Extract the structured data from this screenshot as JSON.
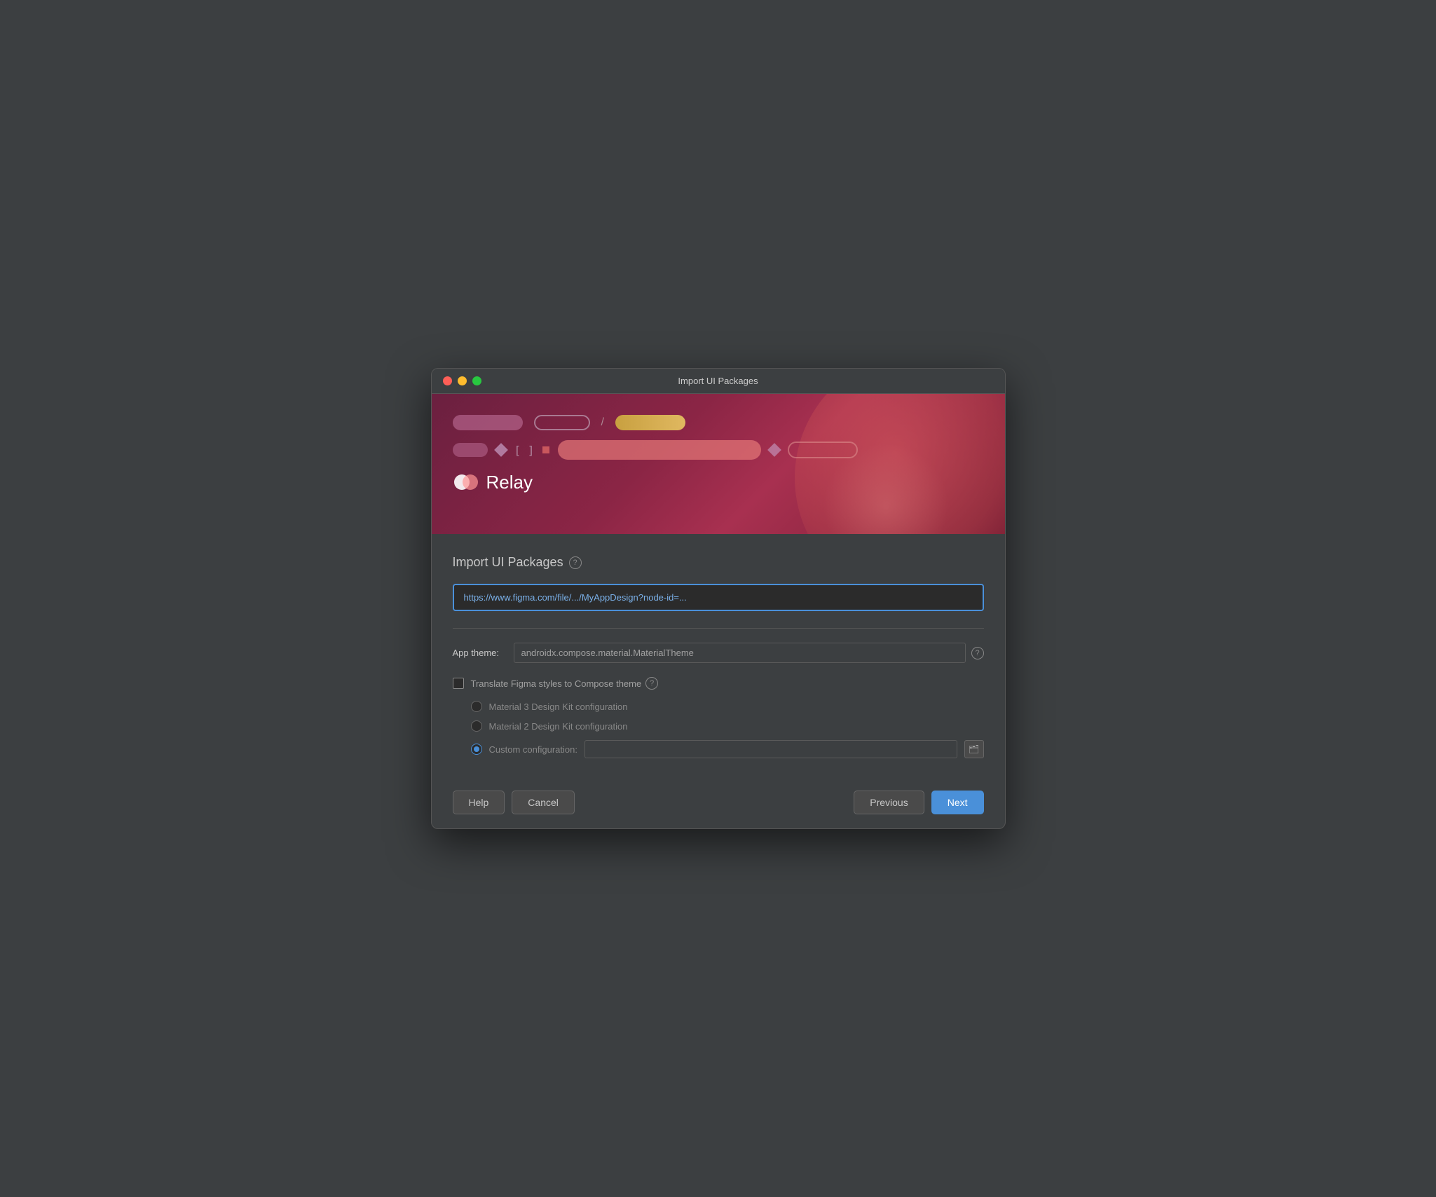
{
  "window": {
    "title": "Import UI Packages"
  },
  "banner": {
    "relay_label": "Relay"
  },
  "form": {
    "title": "Import UI Packages",
    "help_icon": "?",
    "url_placeholder": "https://www.figma.com/file/.../MyAppDesign?node-id=...",
    "url_value": "https://www.figma.com/file/.../MyAppDesign?node-id=...",
    "app_theme_label": "App theme:",
    "app_theme_value": "androidx.compose.material.MaterialTheme",
    "app_theme_placeholder": "androidx.compose.material.MaterialTheme",
    "translate_checkbox_label": "Translate Figma styles to Compose theme",
    "radio_material3_label": "Material 3 Design Kit configuration",
    "radio_material2_label": "Material 2 Design Kit configuration",
    "radio_custom_label": "Custom configuration:",
    "custom_input_value": "",
    "custom_input_placeholder": ""
  },
  "footer": {
    "help_label": "Help",
    "cancel_label": "Cancel",
    "previous_label": "Previous",
    "next_label": "Next"
  }
}
